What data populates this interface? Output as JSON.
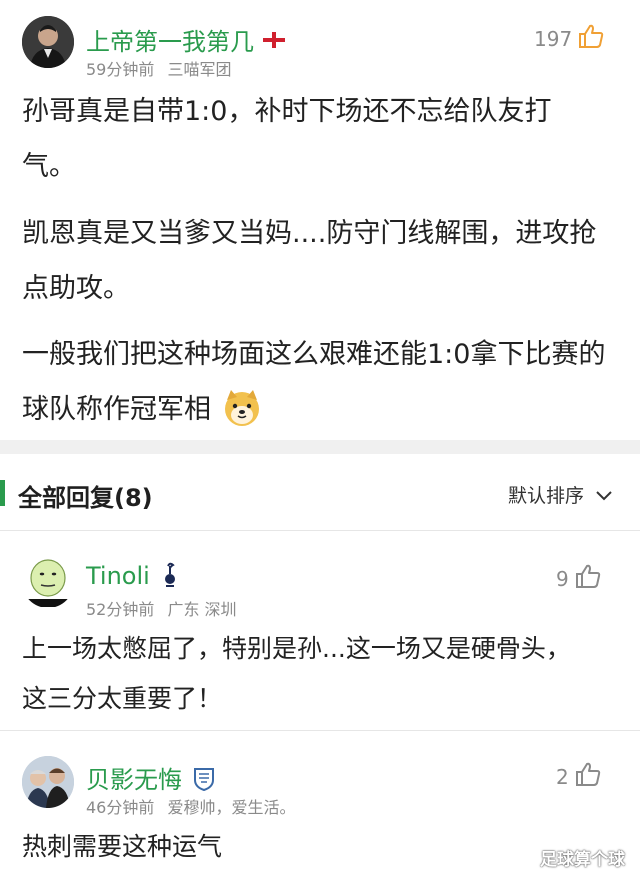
{
  "main_comment": {
    "username": "上帝第一我第几",
    "badge_icon": "england-flag-icon",
    "time": "59分钟前",
    "location": "三喵军团",
    "likes": "197",
    "paragraphs": [
      "孙哥真是自带1:0，补时下场还不忘给队友打气。",
      "凯恩真是又当爹又当妈....防守门线解围，进攻抢点助攻。",
      "一般我们把这种场面这么艰难还能1:0拿下比赛的球队称作冠军相"
    ],
    "emoji_icon": "shiba-dog-emoji-icon"
  },
  "replies_header": {
    "title": "全部回复(8)",
    "sort_label": "默认排序"
  },
  "replies": [
    {
      "username": "Tinoli",
      "badge_icon": "tottenham-cockerel-icon",
      "time": "52分钟前",
      "location": "广东 深圳",
      "likes": "9",
      "text": "上一场太憋屈了，特别是孙...这一场又是硬骨头，这三分太重要了！"
    },
    {
      "username": "贝影无悔",
      "badge_icon": "club-crest-icon",
      "time": "46分钟前",
      "location": "爱穆帅，爱生活。",
      "likes": "2",
      "text": "热刺需要这种运气"
    }
  ],
  "watermark": "足球算个球",
  "colors": {
    "username": "#2a9b4d",
    "accent_bar": "#2a9b4d",
    "meta": "#8a8a8a",
    "thumb": "#f0a035"
  }
}
